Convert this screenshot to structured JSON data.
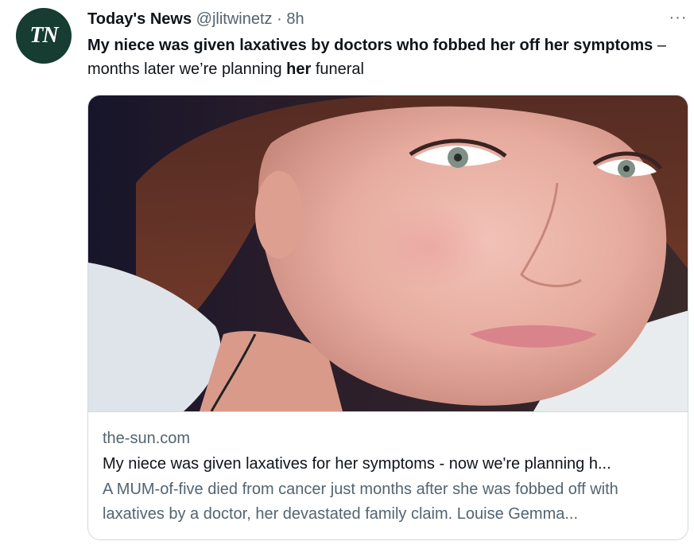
{
  "tweet": {
    "avatar_text": "TN",
    "author_name": "Today's News",
    "handle": "@jlitwinetz",
    "separator": "·",
    "time": "8h",
    "more_label": "···",
    "text_bold_1": "My niece was given laxatives by doctors who fobbed her off her symptoms",
    "text_plain_1": " – months later we’re planning ",
    "text_bold_2": "her",
    "text_plain_2": " funeral"
  },
  "card": {
    "domain": "the-sun.com",
    "title": "My niece was given laxatives for her symptoms - now we're planning h...",
    "description": "A MUM-of-five died from cancer just months after she was fobbed off with laxatives by a doctor, her devastated family claim. Louise Gemma..."
  },
  "colors": {
    "avatar_bg": "#173c31",
    "secondary_text": "#536471",
    "border": "#cfd9de"
  }
}
